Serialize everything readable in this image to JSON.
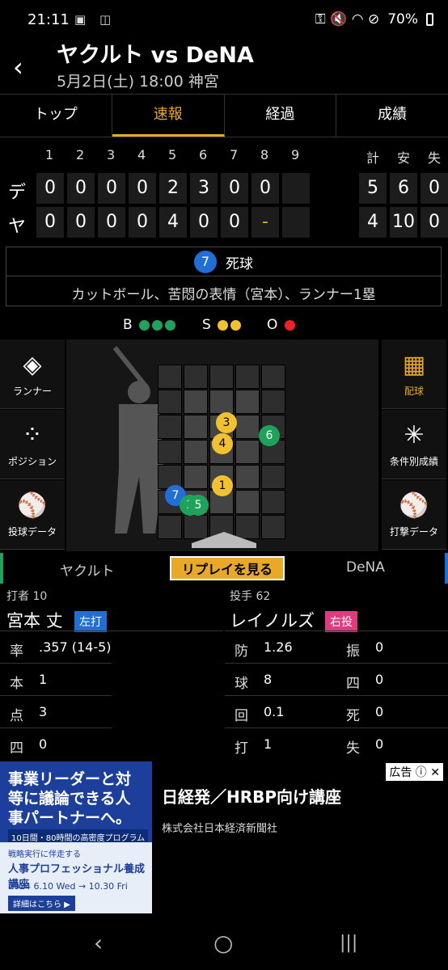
{
  "status": {
    "time": "21:11",
    "left_icons": "▣ ◫",
    "right_icons": "⚿ 🔇 ◠ ⊘",
    "battery": "70%"
  },
  "header": {
    "back_icon": "back-arrow-icon",
    "title": "ヤクルト vs DeNA",
    "subtitle": "5月2日(土) 18:00 神宮"
  },
  "tabs": [
    {
      "label": "トップ",
      "active": false
    },
    {
      "label": "速報",
      "active": true
    },
    {
      "label": "経過",
      "active": false
    },
    {
      "label": "成績",
      "active": false
    }
  ],
  "scoreboard": {
    "innings": [
      "1",
      "2",
      "3",
      "4",
      "5",
      "6",
      "7",
      "8",
      "9"
    ],
    "totals_headers": [
      "計",
      "安",
      "失"
    ],
    "rows": [
      {
        "team": "デ",
        "scores": [
          "0",
          "0",
          "0",
          "0",
          "2",
          "3",
          "0",
          "0",
          ""
        ],
        "totals": [
          "5",
          "6",
          "0"
        ]
      },
      {
        "team": "ヤ",
        "scores": [
          "0",
          "0",
          "0",
          "0",
          "4",
          "0",
          "0",
          "-",
          ""
        ],
        "totals": [
          "4",
          "10",
          "0"
        ]
      }
    ]
  },
  "play": {
    "number": "7",
    "type": "死球",
    "description": "カットボール、苦悶の表情（宮本）、ランナー1塁"
  },
  "count": {
    "b_label": "B",
    "s_label": "S",
    "o_label": "O",
    "balls": 3,
    "strikes": 2,
    "outs": 1
  },
  "side_left": [
    {
      "label": "ランナー",
      "icon": "diamond-icon",
      "glyph": "◈"
    },
    {
      "label": "ポジション",
      "icon": "field-positions-icon",
      "glyph": "⁘"
    },
    {
      "label": "投球データ",
      "icon": "pitcher-icon",
      "glyph": "⚾"
    }
  ],
  "side_right": [
    {
      "label": "配球",
      "icon": "pitch-grid-icon",
      "glyph": "▦",
      "active": true
    },
    {
      "label": "条件別成績",
      "icon": "radar-chart-icon",
      "glyph": "✳",
      "active": false
    },
    {
      "label": "打撃データ",
      "icon": "batter-icon",
      "glyph": "⚾",
      "active": false
    }
  ],
  "pitches": [
    {
      "n": "3",
      "color": "y"
    },
    {
      "n": "4",
      "color": "y"
    },
    {
      "n": "6",
      "color": "g"
    },
    {
      "n": "1",
      "color": "y"
    },
    {
      "n": "7",
      "color": "b"
    },
    {
      "n": "2",
      "color": "g"
    },
    {
      "n": "5",
      "color": "g"
    }
  ],
  "replay": {
    "left_team": "ヤクルト",
    "button": "リプレイを見る",
    "right_team": "DeNA"
  },
  "batter": {
    "role_num": "打者 10",
    "name": "宮本 丈",
    "badge": "左打",
    "stats": [
      {
        "label": "率",
        "value": ".357 (14-5)"
      },
      {
        "label": "本",
        "value": "1"
      },
      {
        "label": "点",
        "value": "3"
      },
      {
        "label": "四",
        "value": "0"
      }
    ]
  },
  "pitcher": {
    "role_num": "投手 62",
    "name": "レイノルズ",
    "badge": "右投",
    "stats": [
      {
        "label": "防",
        "value": "1.26",
        "label2": "振",
        "value2": "0"
      },
      {
        "label": "球",
        "value": "8",
        "label2": "四",
        "value2": "0"
      },
      {
        "label": "回",
        "value": "0.1",
        "label2": "死",
        "value2": "0"
      },
      {
        "label": "打",
        "value": "1",
        "label2": "失",
        "value2": "0"
      }
    ]
  },
  "ad": {
    "img_line1": "事業リーダーと対等に議論できる人事パートナーへ。",
    "img_line2": "10日間・80時間の高密度プログラム",
    "img_line3a": "戦略実行に伴走する",
    "img_line3b": "人事プロフェッショナル養成講座",
    "img_line3c": "2024 6.10 Wed → 10.30 Fri",
    "img_line3d": "詳細はこちら ▶",
    "title": "日経発／HRBP向け講座",
    "corp": "株式会社日本経済新聞社",
    "tag": "広告 ⓘ ✕"
  },
  "nav": {
    "back": "‹",
    "home": "○",
    "recent": "|||"
  }
}
